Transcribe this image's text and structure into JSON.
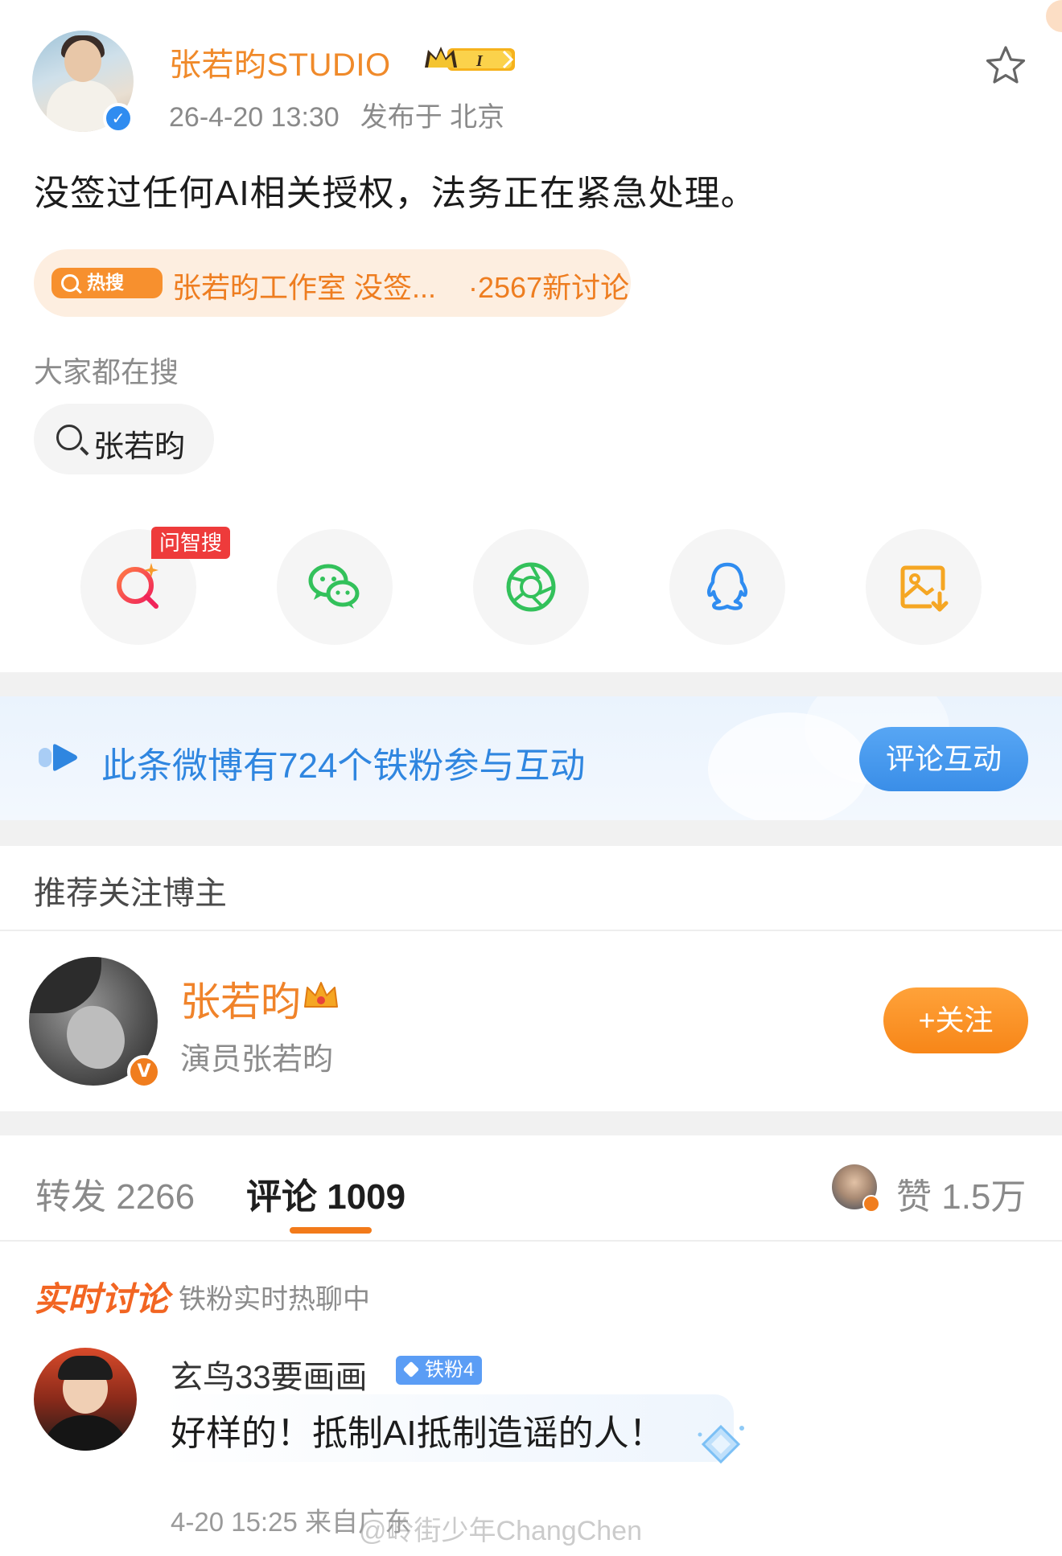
{
  "post": {
    "author": "张若昀STUDIO",
    "level_badge": "I",
    "time": "26-4-20 13:30",
    "location": "发布于 北京",
    "text": "没签过任何AI相关授权，法务正在紧急处理。"
  },
  "hot_search": {
    "tag": "热搜",
    "title": "张若昀工作室 没签...",
    "count": "·2567新讨论"
  },
  "related_search": {
    "label": "大家都在搜",
    "query": "张若昀"
  },
  "share": {
    "ai_badge": "问智搜",
    "items": [
      "ai-search-icon",
      "wechat-icon",
      "moments-icon",
      "qq-icon",
      "save-image-icon"
    ]
  },
  "fans_banner": {
    "text": "此条微博有724个铁粉参与互动",
    "button": "评论互动"
  },
  "recommend": {
    "title": "推荐关注博主",
    "name": "张若昀",
    "desc": "演员张若昀",
    "follow": "+关注"
  },
  "tabs": {
    "repost": "转发 2266",
    "comment": "评论 1009",
    "likes": "赞 1.5万"
  },
  "live": {
    "title": "实时讨论",
    "subtitle": "铁粉实时热聊中"
  },
  "comment": {
    "user": "玄鸟33要画画",
    "fan_level": "铁粉4",
    "text": "好样的！抵制AI抵制造谣的人！",
    "meta": "4-20 15:25  来自广东"
  },
  "watermark": "@岭街少年ChangChen",
  "colors": {
    "accent_orange": "#f08a2a",
    "verify_blue": "#2f8cf0",
    "link_blue": "#2f86e0"
  }
}
